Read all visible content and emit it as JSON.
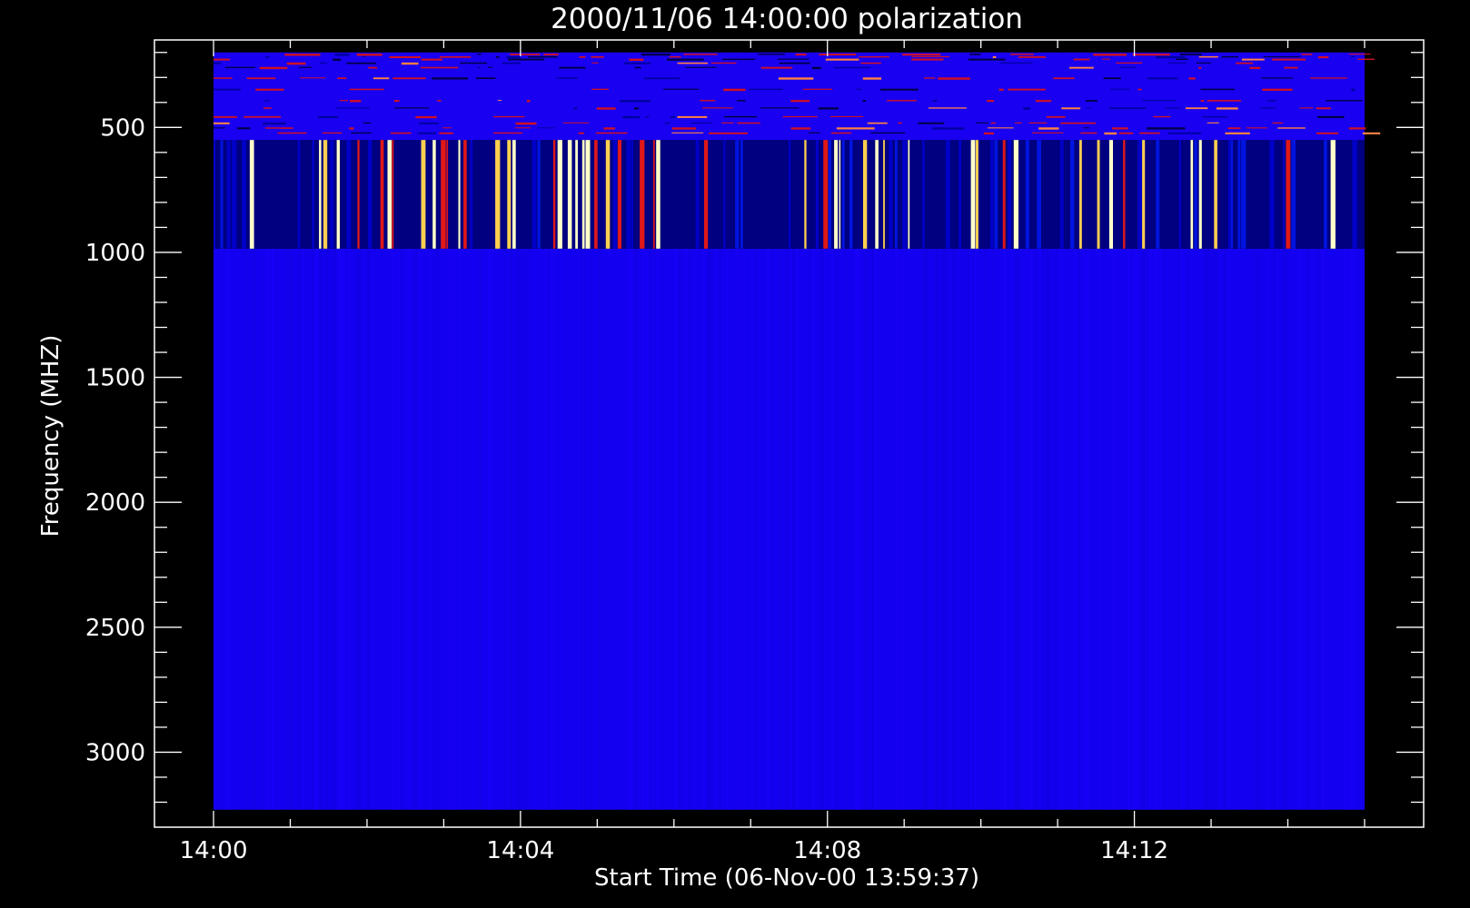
{
  "chart_data": {
    "type": "heatmap",
    "title": "2000/11/06 14:00:00 polarization",
    "xlabel": "Start Time (06-Nov-00 13:59:37)",
    "ylabel": "Frequency (MHZ)",
    "xticks": [
      "14:00",
      "14:04",
      "14:08",
      "14:12"
    ],
    "xtick_minutes": [
      0,
      4,
      8,
      12
    ],
    "x_range_minutes": [
      -0.77,
      15.77
    ],
    "data_x_range_minutes": [
      0,
      15
    ],
    "yticks": [
      500,
      1000,
      1500,
      2000,
      2500,
      3000
    ],
    "ylim": [
      3300,
      150
    ],
    "data_y_range": [
      200,
      3230
    ],
    "bands": [
      {
        "name": "low",
        "freq_range": [
          200,
          550
        ],
        "texture": "horizontal-streaks"
      },
      {
        "name": "mid",
        "freq_range": [
          550,
          985
        ],
        "texture": "vertical-bursts"
      },
      {
        "name": "high",
        "freq_range": [
          985,
          3230
        ],
        "texture": "uniform"
      }
    ],
    "colormap": [
      "#000080",
      "#0000d8",
      "#1400f0",
      "#d01020",
      "#ff3010",
      "#ffc040",
      "#ffffc0"
    ],
    "background_color": "#000000",
    "axis_color": "#ffffff",
    "grid": false
  }
}
